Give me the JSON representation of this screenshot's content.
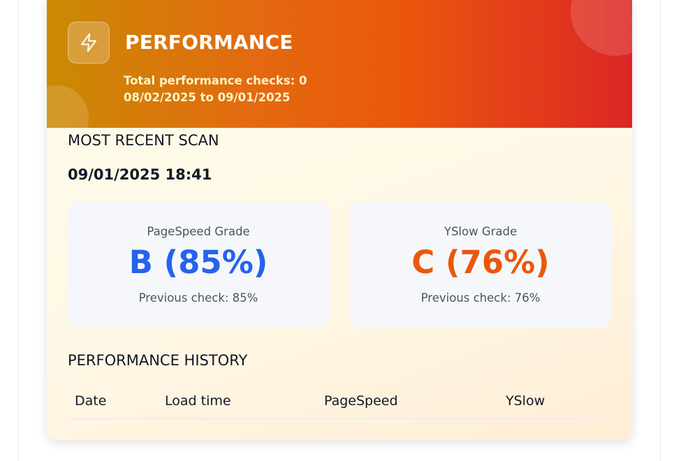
{
  "header": {
    "title": "PERFORMANCE",
    "icon": "lightning-bolt-icon",
    "total_checks": "Total performance checks: 0",
    "date_range": "08/02/2025 to 09/01/2025"
  },
  "recent_scan": {
    "heading": "MOST RECENT SCAN",
    "timestamp": "09/01/2025 18:41"
  },
  "grades": [
    {
      "label": "PageSpeed Grade",
      "value": "B (85%)",
      "previous": "Previous check: 85%",
      "color": "#2563eb"
    },
    {
      "label": "YSlow Grade",
      "value": "C (76%)",
      "previous": "Previous check: 76%",
      "color": "#ea580c"
    }
  ],
  "history": {
    "heading": "PERFORMANCE HISTORY",
    "columns": [
      "Date",
      "Load time",
      "PageSpeed",
      "YSlow"
    ]
  },
  "colors": {
    "header_gradient_start": "#ca8a04",
    "header_gradient_end": "#dc2626",
    "pagespeed_accent": "#2563eb",
    "yslow_accent": "#ea580c"
  }
}
